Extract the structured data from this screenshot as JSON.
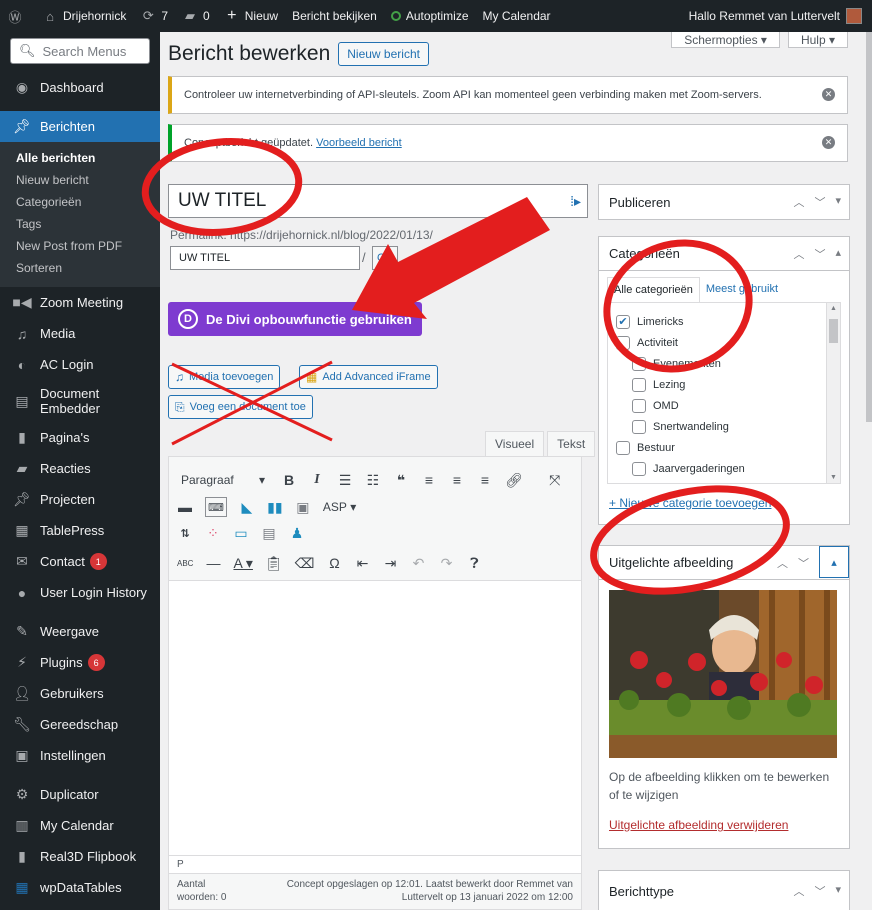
{
  "adminbar": {
    "site_name": "Drijehornick",
    "updates_count": "7",
    "comments_count": "0",
    "new_label": "Nieuw",
    "view_post_label": "Bericht bekijken",
    "autoptimize_label": "Autoptimize",
    "calendar_label": "My Calendar",
    "greeting": "Hallo Remmet van Luttervelt"
  },
  "sidebar": {
    "search_placeholder": "Search Menus",
    "dashboard": "Dashboard",
    "posts": "Berichten",
    "submenu": [
      "Alle berichten",
      "Nieuw bericht",
      "Categorieën",
      "Tags",
      "New Post from PDF",
      "Sorteren"
    ],
    "zoom": "Zoom Meeting",
    "media": "Media",
    "ac_login": "AC Login",
    "document_embedder": "Document Embedder",
    "pages": "Pagina's",
    "comments": "Reacties",
    "projects": "Projecten",
    "tablepress": "TablePress",
    "contact": "Contact",
    "contact_badge": "1",
    "user_login_history": "User Login History",
    "appearance": "Weergave",
    "plugins": "Plugins",
    "plugins_badge": "6",
    "users": "Gebruikers",
    "tools": "Gereedschap",
    "settings": "Instellingen",
    "duplicator": "Duplicator",
    "my_calendar": "My Calendar",
    "flipbook": "Real3D Flipbook",
    "wpdatatables": "wpDataTables"
  },
  "header": {
    "screen_options": "Schermopties",
    "help": "Hulp",
    "page_title": "Bericht bewerken",
    "add_new": "Nieuw bericht"
  },
  "notices": {
    "zoom_warning": "Controleer uw internetverbinding of API-sleutels. Zoom API kan momenteel geen verbinding maken met Zoom-servers.",
    "draft_text": "Conceptbericht geüpdatet.",
    "draft_link": "Voorbeeld bericht"
  },
  "editor": {
    "title_value": "UW TITEL",
    "permalink_label": "Permalink:",
    "permalink_url": "https://drijehornick.nl/blog/2022/01/13/",
    "slug_value": "UW TITEL",
    "slug_ok": "OK",
    "divi_button": "De Divi opbouwfunctie gebruiken",
    "add_media": "Media toevoegen",
    "add_iframe": "Add Advanced iFrame",
    "add_document": "Voeg een document toe",
    "tab_visual": "Visueel",
    "tab_text": "Tekst",
    "format_select": "Paragraaf",
    "asp_label": "ASP",
    "path": "P",
    "word_count_label": "Aantal woorden: 0",
    "autosave": "Concept opgeslagen op 12:01. Laatst bewerkt door Remmet van Luttervelt op 13 januari 2022 om 12:00"
  },
  "publish": {
    "title": "Publiceren"
  },
  "categories": {
    "title": "Categorieën",
    "tab_all": "Alle categorieën",
    "tab_popular": "Meest gebruikt",
    "items": [
      {
        "label": "Limericks",
        "checked": true,
        "child": false
      },
      {
        "label": "Activiteit",
        "checked": false,
        "child": false
      },
      {
        "label": "Evenementen",
        "checked": false,
        "child": true
      },
      {
        "label": "Lezing",
        "checked": false,
        "child": true
      },
      {
        "label": "OMD",
        "checked": false,
        "child": true
      },
      {
        "label": "Snertwandeling",
        "checked": false,
        "child": true
      },
      {
        "label": "Bestuur",
        "checked": false,
        "child": false
      },
      {
        "label": "Jaarvergaderingen",
        "checked": false,
        "child": true
      }
    ],
    "add_new": "+ Nieuwe categorie toevoegen"
  },
  "featured": {
    "title": "Uitgelichte afbeelding",
    "caption": "Op de afbeelding klikken om te bewerken of te wijzigen",
    "remove": "Uitgelichte afbeelding verwijderen"
  },
  "post_type": {
    "title": "Berichttype"
  },
  "colors": {
    "admin_bg": "#1d2327",
    "accent": "#2271b1",
    "divi_purple": "#7e3bd0",
    "annotation_red": "#e31e1e"
  }
}
